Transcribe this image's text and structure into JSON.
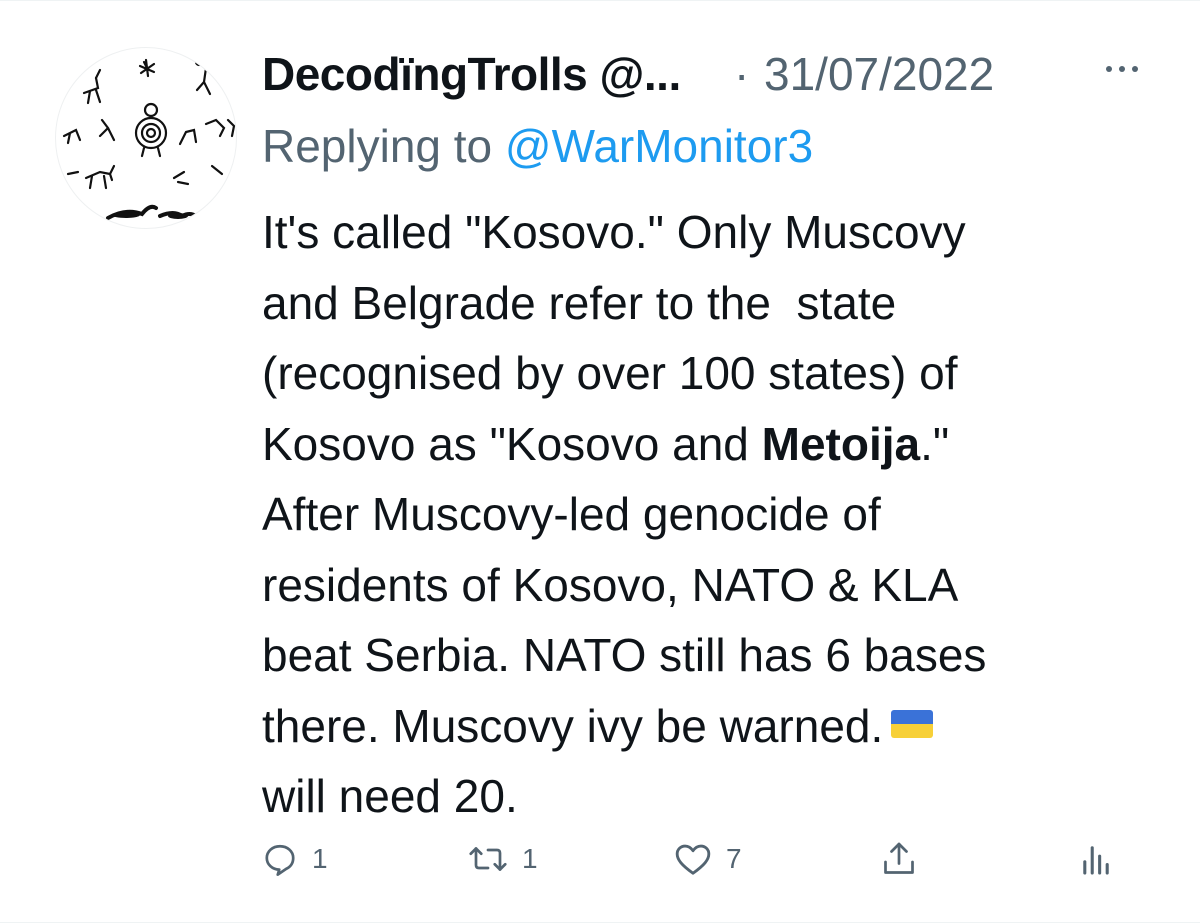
{
  "tweet": {
    "display_name": "DecodïngTrolls @...",
    "separator": "·",
    "timestamp": "31/07/2022",
    "replying_prefix": "Replying to ",
    "replying_handle": "@WarMonitor3",
    "body_lines": [
      "It's called \"Kosovo.\" Only Muscovy",
      "and Belgrade refer to the  state",
      "(recognised by over 100 states) of",
      "Kosovo as \"Kosovo and ",
      "Metoija",
      ".\"",
      "After Muscovy-led genocide of",
      "residents of Kosovo, NATO & KLA",
      "beat Serbia. NATO still has 6 bases",
      "there. Muscovy ivy be warned.",
      "will need 20."
    ],
    "emoji": "ukraine-flag",
    "flag_colors": {
      "top": "#3a72d8",
      "bottom": "#f7d038"
    }
  },
  "actions": {
    "reply_count": "1",
    "retweet_count": "1",
    "like_count": "7",
    "share_label": "",
    "analytics_label": ""
  },
  "colors": {
    "text": "#0f1419",
    "secondary": "#536471",
    "link": "#1d9bf0"
  }
}
